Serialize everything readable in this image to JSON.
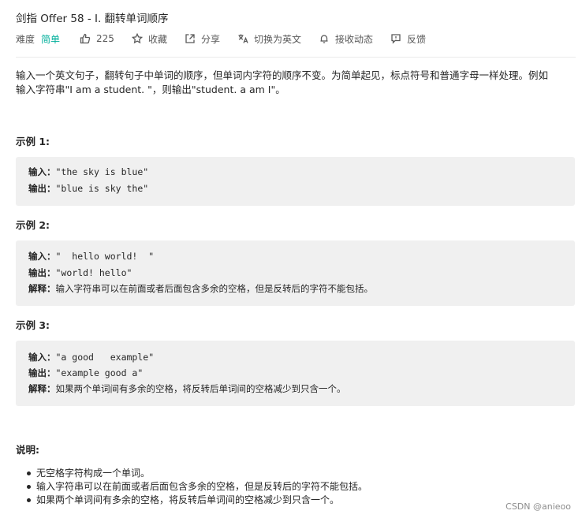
{
  "problem": {
    "title": "剑指 Offer 58 - I. 翻转单词顺序",
    "difficulty_label": "难度",
    "difficulty": "简单",
    "actions": {
      "likes": "225",
      "favorite": "收藏",
      "share": "分享",
      "translate": "切换为英文",
      "subscribe": "接收动态",
      "feedback": "反馈"
    },
    "description_line1": "输入一个英文句子，翻转句子中单词的顺序，但单词内字符的顺序不变。为简单起见，标点符号和普通字母一样处理。例如",
    "description_line2": "输入字符串\"I am a student. \"，则输出\"student. a am I\"。"
  },
  "examples": [
    {
      "heading": "示例 1:",
      "input_label": "输入：",
      "input": "\"the sky is blue\"",
      "output_label": "输出：",
      "output": "\"blue is sky the\""
    },
    {
      "heading": "示例 2:",
      "input_label": "输入：",
      "input": "\"  hello world!  \"",
      "output_label": "输出：",
      "output": "\"world! hello\"",
      "explain_label": "解释：",
      "explain": "输入字符串可以在前面或者后面包含多余的空格，但是反转后的字符不能包括。"
    },
    {
      "heading": "示例 3:",
      "input_label": "输入：",
      "input": "\"a good   example\"",
      "output_label": "输出：",
      "output": "\"example good a\"",
      "explain_label": "解释：",
      "explain": "如果两个单词间有多余的空格，将反转后单词间的空格减少到只含一个。"
    }
  ],
  "notes": {
    "heading": "说明:",
    "items": [
      "无空格字符构成一个单词。",
      "输入字符串可以在前面或者后面包含多余的空格，但是反转后的字符不能包括。",
      "如果两个单词间有多余的空格，将反转后单词间的空格减少到只含一个。"
    ]
  },
  "watermark": "CSDN @anieoo"
}
